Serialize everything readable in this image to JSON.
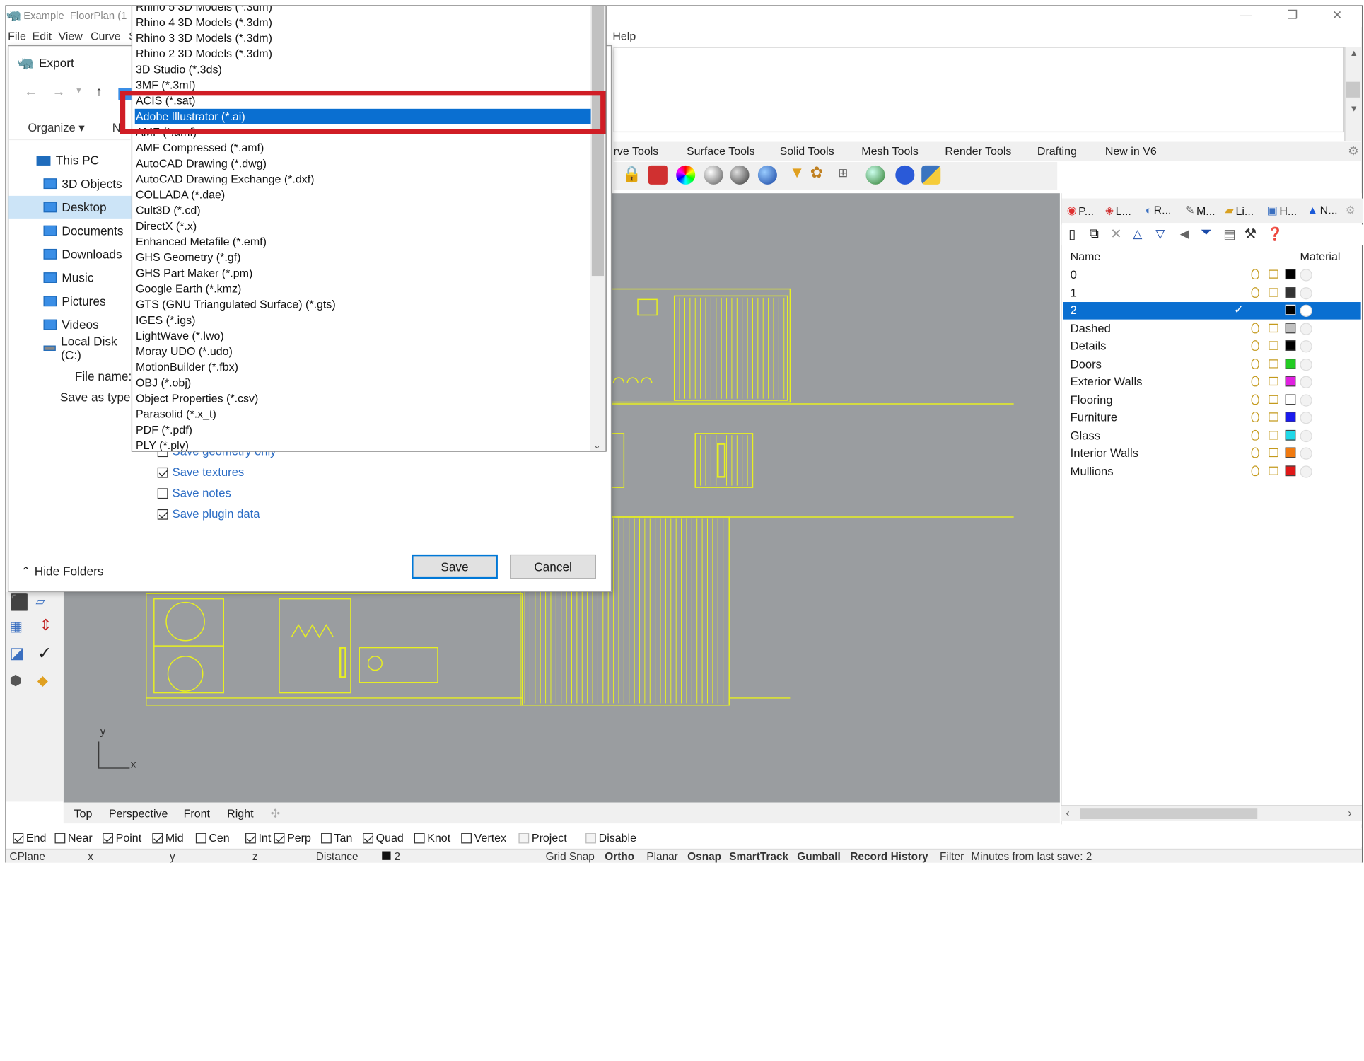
{
  "window": {
    "title": "Example_FloorPlan (1",
    "menu": [
      "File",
      "Edit",
      "View",
      "Curve",
      "S",
      "Help"
    ],
    "minimize": "—",
    "restore": "❐",
    "close": "✕"
  },
  "toolbar_tabs": [
    "rve Tools",
    "Surface Tools",
    "Solid Tools",
    "Mesh Tools",
    "Render Tools",
    "Drafting",
    "New in V6"
  ],
  "export_dialog": {
    "title": "Export",
    "organize": "Organize ▾",
    "organize_next": "N",
    "tree": [
      {
        "label": "This PC",
        "selected": false
      },
      {
        "label": "3D Objects",
        "selected": false
      },
      {
        "label": "Desktop",
        "selected": true
      },
      {
        "label": "Documents",
        "selected": false
      },
      {
        "label": "Downloads",
        "selected": false
      },
      {
        "label": "Music",
        "selected": false
      },
      {
        "label": "Pictures",
        "selected": false
      },
      {
        "label": "Videos",
        "selected": false
      },
      {
        "label": "Local Disk (C:)",
        "selected": false
      }
    ],
    "file_name_label": "File name:",
    "save_as_type_label": "Save as type:",
    "options": [
      {
        "label": "Save geometry only",
        "checked": false
      },
      {
        "label": "Save textures",
        "checked": true
      },
      {
        "label": "Save notes",
        "checked": false
      },
      {
        "label": "Save plugin data",
        "checked": true
      }
    ],
    "save_button": "Save",
    "cancel_button": "Cancel",
    "hide_folders": "Hide Folders"
  },
  "file_types": [
    "Rhino 5 3D Models (*.3dm)",
    "Rhino 4 3D Models (*.3dm)",
    "Rhino 3 3D Models (*.3dm)",
    "Rhino 2 3D Models (*.3dm)",
    "3D Studio (*.3ds)",
    "3MF (*.3mf)",
    "ACIS (*.sat)",
    "Adobe Illustrator (*.ai)",
    "AMF (*.amf)",
    "AMF Compressed (*.amf)",
    "AutoCAD Drawing (*.dwg)",
    "AutoCAD Drawing Exchange (*.dxf)",
    "COLLADA (*.dae)",
    "Cult3D (*.cd)",
    "DirectX (*.x)",
    "Enhanced Metafile (*.emf)",
    "GHS Geometry (*.gf)",
    "GHS Part Maker (*.pm)",
    "Google Earth (*.kmz)",
    "GTS (GNU Triangulated Surface) (*.gts)",
    "IGES (*.igs)",
    "LightWave (*.lwo)",
    "Moray UDO (*.udo)",
    "MotionBuilder (*.fbx)",
    "OBJ (*.obj)",
    "Object Properties (*.csv)",
    "Parasolid (*.x_t)",
    "PDF (*.pdf)",
    "PLY (*.ply)"
  ],
  "selected_file_type": "Adobe Illustrator (*.ai)",
  "panel": {
    "tabs": [
      "P...",
      "L...",
      "R...",
      "M...",
      "Li...",
      "H...",
      "N..."
    ],
    "col_name": "Name",
    "col_material": "Material",
    "layers": [
      {
        "name": "0",
        "color": "#000000",
        "current": false
      },
      {
        "name": "1",
        "color": "#333333",
        "current": false
      },
      {
        "name": "2",
        "color": "#000000",
        "current": true
      },
      {
        "name": "Dashed",
        "color": "#c0c0c0",
        "current": false
      },
      {
        "name": "Details",
        "color": "#000000",
        "current": false
      },
      {
        "name": "Doors",
        "color": "#22cc22",
        "current": false
      },
      {
        "name": "Exterior Walls",
        "color": "#e020e0",
        "current": false
      },
      {
        "name": "Flooring",
        "color": "#ffffff",
        "current": false
      },
      {
        "name": "Furniture",
        "color": "#1a1aee",
        "current": false
      },
      {
        "name": "Glass",
        "color": "#20d8e8",
        "current": false
      },
      {
        "name": "Interior Walls",
        "color": "#f07a10",
        "current": false
      },
      {
        "name": "Mullions",
        "color": "#e01818",
        "current": false
      }
    ]
  },
  "viewport_tabs": [
    "Top",
    "Perspective",
    "Front",
    "Right"
  ],
  "axis": {
    "x": "x",
    "y": "y"
  },
  "osnaps": [
    {
      "label": "End",
      "on": true
    },
    {
      "label": "Near",
      "on": false
    },
    {
      "label": "Point",
      "on": true
    },
    {
      "label": "Mid",
      "on": true
    },
    {
      "label": "Cen",
      "on": false
    },
    {
      "label": "Int",
      "on": true
    },
    {
      "label": "Perp",
      "on": true
    },
    {
      "label": "Tan",
      "on": false
    },
    {
      "label": "Quad",
      "on": true
    },
    {
      "label": "Knot",
      "on": false
    },
    {
      "label": "Vertex",
      "on": false
    },
    {
      "label": "Project",
      "on": false
    },
    {
      "label": "Disable",
      "on": false
    }
  ],
  "status": {
    "cplane": "CPlane",
    "x": "x",
    "y": "y",
    "z": "z",
    "distance": "Distance",
    "layer": "2",
    "grid_snap": "Grid Snap",
    "ortho": "Ortho",
    "planar": "Planar",
    "osnap": "Osnap",
    "smarttrack": "SmartTrack",
    "gumball": "Gumball",
    "record_history": "Record History",
    "filter": "Filter",
    "minutes": "Minutes from last save: 2"
  },
  "colors": {
    "accent": "#0a6fd1",
    "highlight_box": "#d01d25",
    "viewport_bg": "#9a9da0",
    "plan_lines": "#e8f020"
  }
}
